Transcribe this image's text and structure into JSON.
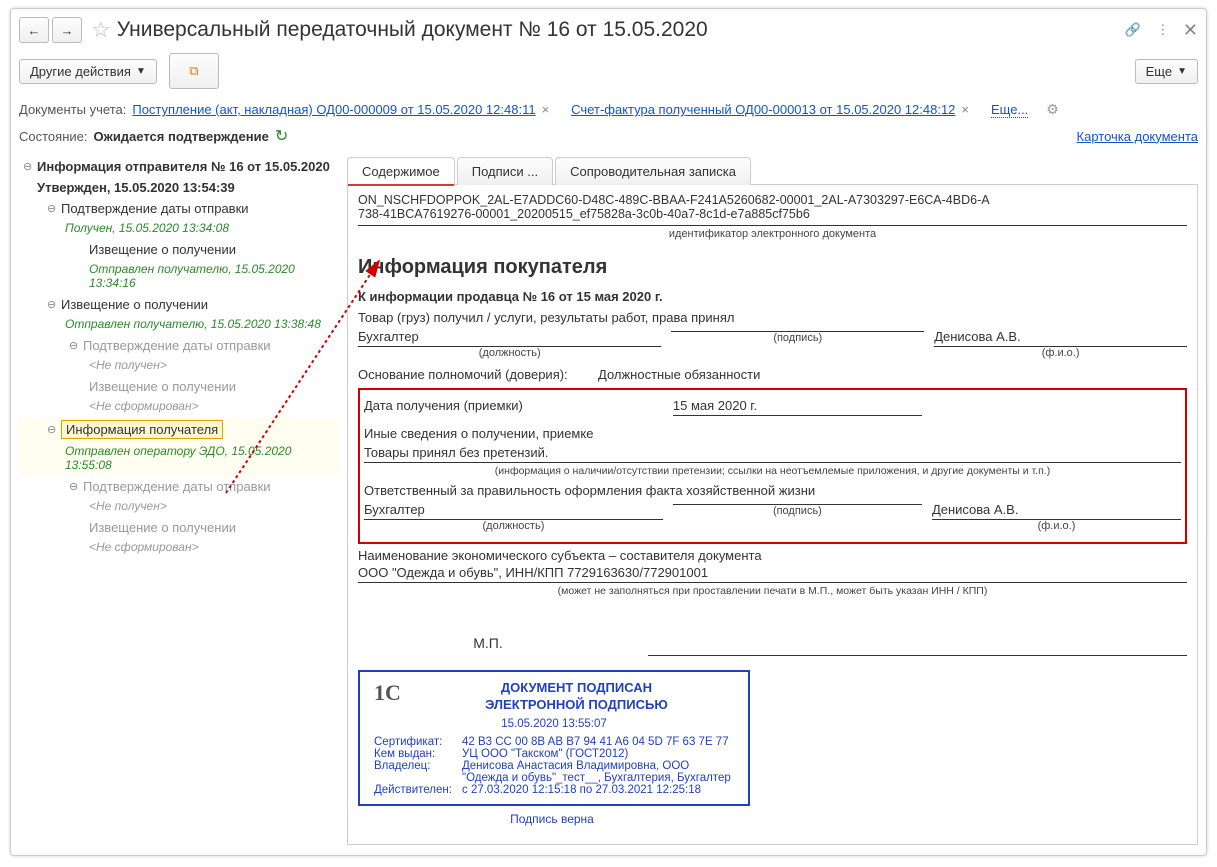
{
  "title": "Универсальный передаточный документ № 16 от 15.05.2020",
  "toolbar": {
    "other_actions": "Другие действия",
    "more": "Еще"
  },
  "docs_line": {
    "label": "Документы учета:",
    "link1": "Поступление (акт, накладная) ОД00-000009 от 15.05.2020 12:48:11",
    "link2": "Счет-фактура полученный ОД00-000013 от 15.05.2020 12:48:12",
    "more": "Еще..."
  },
  "state_line": {
    "label": "Состояние:",
    "value": "Ожидается подтверждение"
  },
  "card_link": "Карточка документа",
  "tree": {
    "root": "Информация отправителя № 16 от 15.05.2020",
    "root_status": "Утвержден, 15.05.2020 13:54:39",
    "n1": "Подтверждение даты отправки",
    "n1_status": "Получен, 15.05.2020 13:34:08",
    "n1a": "Извещение о получении",
    "n1a_status": "Отправлен получателю, 15.05.2020 13:34:16",
    "n2": "Извещение о получении",
    "n2_status": "Отправлен получателю, 15.05.2020 13:38:48",
    "n2a": "Подтверждение даты отправки",
    "n2a_status": "<Не получен>",
    "n2b": "Извещение о получении",
    "n2b_status": "<Не сформирован>",
    "n3": "Информация получателя",
    "n3_status": "Отправлен оператору ЭДО, 15.05.2020 13:55:08",
    "n3a": "Подтверждение даты отправки",
    "n3a_status": "<Не получен>",
    "n3b": "Извещение о получении",
    "n3b_status": "<Не сформирован>"
  },
  "tabs": {
    "content": "Содержимое",
    "signatures": "Подписи ...",
    "note": "Сопроводительная записка"
  },
  "doc": {
    "id_line1": "ON_NSCHFDOPPOK_2AL-E7ADDC60-D48C-489C-BBAA-F241A5260682-00001_2AL-A7303297-E6CA-4BD6-A",
    "id_line2": "738-41BCA7619276-00001_20200515_ef75828a-3c0b-40a7-8c1d-e7a885cf75b6",
    "id_caption": "идентификатор электронного документа",
    "heading": "Информация покупателя",
    "subheading": "К информации продавца № 16 от 15 мая 2020 г.",
    "goods_line": "Товар (груз) получил / услуги, результаты работ, права принял",
    "position": "Бухгалтер",
    "signature_blank": " ",
    "fio": "Денисова А.В.",
    "cap_position": "(должность)",
    "cap_signature": "(подпись)",
    "cap_fio": "(ф.и.о.)",
    "basis_label": "Основание полномочий (доверия):",
    "basis_value": "Должностные обязанности",
    "date_recv_label": "Дата получения (приемки)",
    "date_recv_value": "15 мая 2020 г.",
    "other_info_label": "Иные сведения о получении, приемке",
    "other_info_value": "Товары принял без претензий.",
    "other_info_caption": "(информация о наличии/отсутствии претензии; ссылки на неотъемлемые приложения, и другие  документы и т.п.)",
    "resp_label": "Ответственный за правильность оформления факта хозяйственной жизни",
    "resp_position": "Бухгалтер",
    "resp_fio": "Денисова А.В.",
    "subj_label": "Наименование экономического субъекта – составителя документа",
    "subj_value": "ООО \"Одежда и обувь\", ИНН/КПП 7729163630/772901001",
    "subj_caption": "(может не заполняться при проставлении печати в М.П., может быть указан ИНН / КПП)",
    "mp": "М.П."
  },
  "sig": {
    "title1": "ДОКУМЕНТ ПОДПИСАН",
    "title2": "ЭЛЕКТРОННОЙ ПОДПИСЬЮ",
    "logo": "1C",
    "date": "15.05.2020  13:55:07",
    "cert_k": "Сертификат:",
    "cert_v": "42 B3 CC 00 8B AB B7 94 41 A6 04 5D 7F 63 7E 77",
    "issued_k": "Кем выдан:",
    "issued_v": "УЦ ООО \"Такском\" (ГОСТ2012)",
    "owner_k": "Владелец:",
    "owner_v": "Денисова Анастасия Владимировна, ООО \"Одежда и обувь\"_тест__, Бухгалтерия, Бухгалтер",
    "valid_k": "Действителен:",
    "valid_v": "с 27.03.2020 12:15:18 по 27.03.2021 12:25:18",
    "ok": "Подпись верна"
  }
}
